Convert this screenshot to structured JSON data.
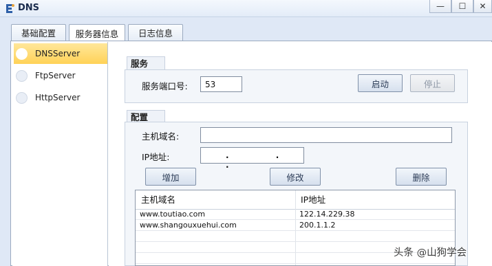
{
  "window": {
    "title": "DNS",
    "minimize": "—",
    "maximize": "☐",
    "close": "✕"
  },
  "tabs": [
    {
      "label": "基础配置"
    },
    {
      "label": "服务器信息"
    },
    {
      "label": "日志信息"
    }
  ],
  "active_tab": "服务器信息",
  "sidebar": {
    "items": [
      {
        "label": "DNSServer",
        "selected": true
      },
      {
        "label": "FtpServer",
        "selected": false
      },
      {
        "label": "HttpServer",
        "selected": false
      }
    ]
  },
  "service": {
    "section_title": "服务",
    "port_label": "服务端口号:",
    "port_value": "53",
    "start_button": "启动",
    "stop_button": "停止"
  },
  "config": {
    "section_title": "配置",
    "host_label": "主机域名:",
    "host_value": "",
    "ip_label": "IP地址:",
    "ip_value": ". . .",
    "add_button": "增加",
    "modify_button": "修改",
    "delete_button": "删除"
  },
  "table": {
    "columns": [
      "主机域名",
      "IP地址"
    ],
    "rows": [
      [
        "www.toutiao.com",
        "122.14.229.38"
      ],
      [
        "www.shangouxuehui.com",
        "200.1.1.2"
      ],
      [
        "",
        ""
      ],
      [
        "",
        ""
      ],
      [
        "",
        ""
      ]
    ]
  },
  "watermark": "头条 @山狗学会",
  "colors": {
    "selected_item": "#ffd257",
    "background": "#dfe8f6"
  }
}
